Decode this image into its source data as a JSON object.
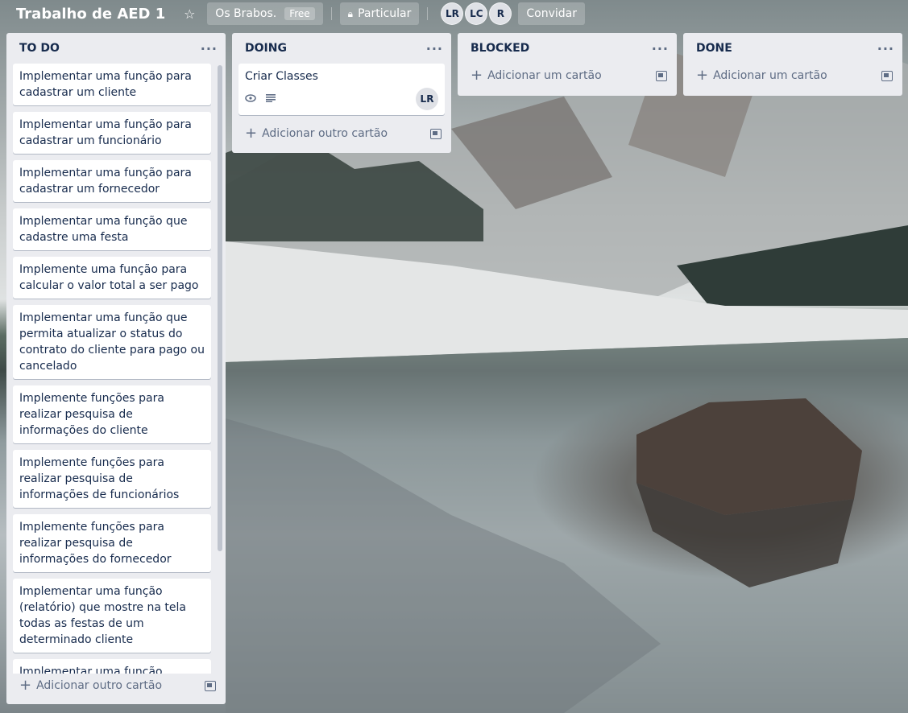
{
  "board": {
    "title": "Trabalho de AED 1",
    "team_label": "Os Brabos.",
    "team_badge": "Free",
    "visibility_label": "Particular",
    "members": [
      "LR",
      "LC",
      "R"
    ],
    "invite_label": "Convidar"
  },
  "icons": {
    "star": "star-icon",
    "lock": "lock-icon",
    "eye": "eye-icon",
    "description": "description-icon",
    "template": "card-template-icon",
    "list_menu": "more-icon"
  },
  "lists": [
    {
      "title": "TO DO",
      "menu": "···",
      "cards": [
        "Implementar uma função para cadastrar um cliente",
        "Implementar uma função para cadastrar um funcionário",
        "Implementar uma função para cadastrar um fornecedor",
        "Implementar uma função que cadastre uma festa",
        "Implemente uma função para calcular o valor total a ser pago",
        "Implementar uma função que permita atualizar o status do contrato do cliente para pago ou cancelado",
        "Implemente funções para realizar pesquisa de informações do cliente",
        "Implemente funções para realizar pesquisa de informações de funcionários",
        "Implemente funções para realizar pesquisa de informações do fornecedor",
        "Implementar uma função (relatório) que mostre na tela todas as festas de um determinado cliente",
        "Implementar uma função (relatório) que mostre na tela as informações de uma determinada festa a partir"
      ],
      "add_label": "Adicionar outro cartão"
    },
    {
      "title": "DOING",
      "menu": "···",
      "cards": [
        "Criar Classes"
      ],
      "card_member": "LR",
      "add_label": "Adicionar outro cartão"
    },
    {
      "title": "BLOCKED",
      "menu": "···",
      "cards": [],
      "add_label": "Adicionar um cartão"
    },
    {
      "title": "DONE",
      "menu": "···",
      "cards": [],
      "add_label": "Adicionar um cartão"
    }
  ]
}
